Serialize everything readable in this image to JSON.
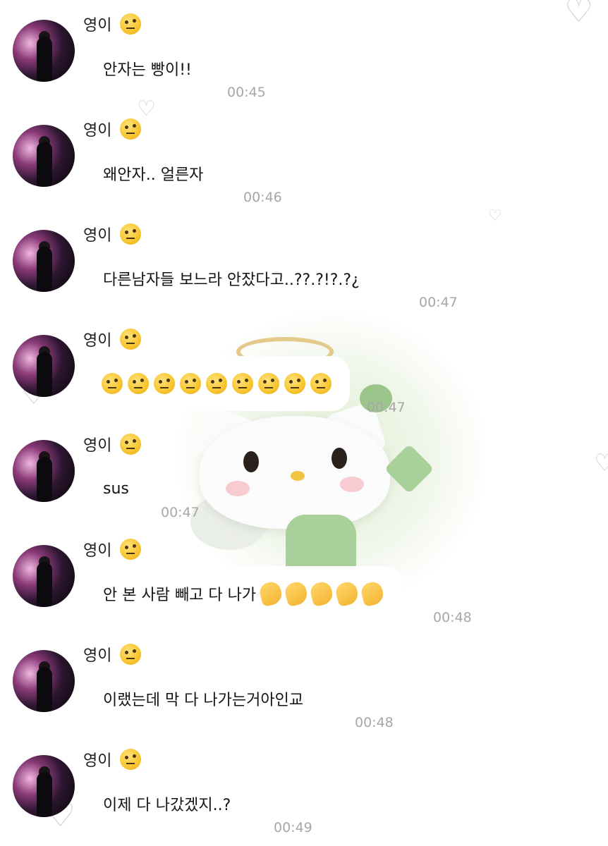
{
  "contact": {
    "name": "영이"
  },
  "messages": [
    {
      "text": "안자는 빵이!!",
      "time": "00:45"
    },
    {
      "text": "왜안자.. 얼른자",
      "time": "00:46"
    },
    {
      "text": "다른남자들 보느라 안잤다고..??.?!?.?¿",
      "time": "00:47"
    },
    {
      "text": "",
      "emoji_count": 9,
      "emoji_name": "face-with-raised-eyebrow",
      "time": "00:47"
    },
    {
      "text": "sus",
      "time": "00:47"
    },
    {
      "text": "안 본 사람 빼고 다 나가",
      "emoji_count": 5,
      "emoji_name": "waving-hand",
      "time": "00:48"
    },
    {
      "text": "이랬는데 막 다 나가는거아인교",
      "time": "00:48"
    },
    {
      "text": "이제 다 나갔겠지..?",
      "time": "00:49"
    }
  ],
  "colors": {
    "bubble": "#ffffff",
    "time": "#a7a7a7",
    "text": "#141414"
  }
}
